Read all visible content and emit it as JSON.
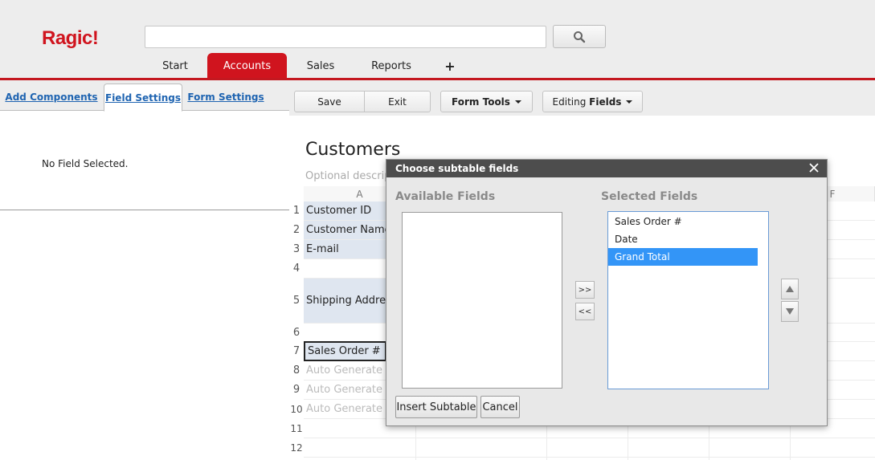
{
  "app": {
    "logo": "Ragic!"
  },
  "header": {
    "search_value": "",
    "search_icon": "magnifier-icon",
    "tabs": [
      {
        "label": "Start",
        "active": false
      },
      {
        "label": "Accounts",
        "active": true
      },
      {
        "label": "Sales",
        "active": false
      },
      {
        "label": "Reports",
        "active": false
      },
      {
        "label": "+",
        "active": false
      }
    ]
  },
  "left_panel": {
    "tabs": [
      {
        "label": "Add Components",
        "active": false
      },
      {
        "label": "Field Settings",
        "active": true
      },
      {
        "label": "Form Settings",
        "active": false
      }
    ],
    "empty_message": "No Field Selected."
  },
  "toolbar": {
    "save_label": "Save",
    "exit_label": "Exit",
    "form_tools_label": "Form Tools",
    "editing_prefix": "Editing",
    "editing_mode": "Fields"
  },
  "sheet": {
    "title": "Customers",
    "description_placeholder": "Optional descrip",
    "columns": [
      "A",
      "F"
    ],
    "rows": [
      {
        "num": "1",
        "value": "Customer ID",
        "kind": "field"
      },
      {
        "num": "2",
        "value": "Customer Name",
        "kind": "field"
      },
      {
        "num": "3",
        "value": "E-mail",
        "kind": "field"
      },
      {
        "num": "4",
        "value": "",
        "kind": "empty"
      },
      {
        "num": "5",
        "value": "Shipping Address",
        "kind": "field"
      },
      {
        "num": "6",
        "value": "",
        "kind": "empty"
      },
      {
        "num": "7",
        "value": "Sales Order #",
        "kind": "selected"
      },
      {
        "num": "8",
        "value": "Auto Generate",
        "kind": "placeholder"
      },
      {
        "num": "9",
        "value": "Auto Generate",
        "kind": "placeholder"
      },
      {
        "num": "10",
        "value": "Auto Generate",
        "kind": "placeholder"
      },
      {
        "num": "11",
        "value": "",
        "kind": "empty"
      },
      {
        "num": "12",
        "value": "",
        "kind": "empty"
      }
    ]
  },
  "dialog": {
    "title": "Choose subtable fields",
    "close_icon": "close-icon",
    "available_label": "Available Fields",
    "selected_label": "Selected Fields",
    "available_fields": [],
    "selected_fields": [
      {
        "label": "Sales Order #",
        "selected": false
      },
      {
        "label": "Date",
        "selected": false
      },
      {
        "label": "Grand Total",
        "selected": true
      }
    ],
    "add_button": ">>",
    "remove_button": "<<",
    "move_up_icon": "triangle-up-icon",
    "move_down_icon": "triangle-down-icon",
    "insert_label": "Insert Subtable",
    "cancel_label": "Cancel"
  }
}
